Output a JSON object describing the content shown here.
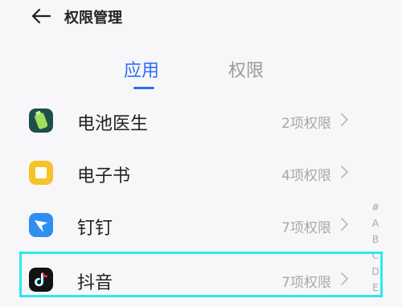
{
  "header": {
    "title": "权限管理",
    "back_icon": "arrow-left-icon"
  },
  "tabs": [
    {
      "label": "应用",
      "active": true,
      "color": "#2d6df6"
    },
    {
      "label": "权限",
      "active": false,
      "color": "#9a9a9a"
    }
  ],
  "apps": [
    {
      "name": "电池医生",
      "permissions": "2项权限",
      "icon": "battery-doctor-icon"
    },
    {
      "name": "电子书",
      "permissions": "4项权限",
      "icon": "ebook-icon"
    },
    {
      "name": "钉钉",
      "permissions": "7项权限",
      "icon": "dingtalk-icon"
    },
    {
      "name": "抖音",
      "permissions": "7项权限",
      "icon": "douyin-icon"
    }
  ],
  "alphabet_index": [
    "#",
    "A",
    "B",
    "C",
    "D",
    "E"
  ],
  "highlight_color": "#2ee6f0"
}
